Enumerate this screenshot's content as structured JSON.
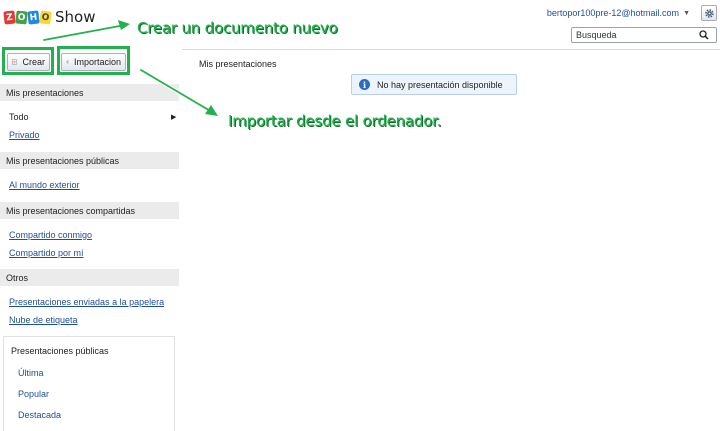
{
  "app": {
    "logo_letters": [
      "Z",
      "O",
      "H",
      "O"
    ],
    "product_name": "Show"
  },
  "header": {
    "user_email": "bertopor100pre-12@hotmail.com",
    "search_placeholder": "Busqueda"
  },
  "toolbar": {
    "create_label": "Crear",
    "import_label": "Importacion"
  },
  "sidebar": {
    "sections": {
      "my_presentations": "Mis presentaciones",
      "public": "Mis presentaciones públicas",
      "shared": "Mis presentaciones compartidas",
      "others": "Otros"
    },
    "all": "Todo",
    "private": "Privado",
    "outside_world": "Al mundo exterior",
    "shared_with_me": "Compartido conmigo",
    "shared_by_me": "Compartido por mí",
    "trash": "Presentaciones enviadas a la papelera",
    "tag_cloud": "Nube de etiqueta",
    "public_box": {
      "title": "Presentaciones públicas",
      "links": [
        "Última",
        "Popular",
        "Destacada"
      ]
    }
  },
  "main": {
    "title": "Mis presentaciones",
    "notice": "No hay presentación disponible"
  },
  "annotations": {
    "create": "Crear un documento nuevo",
    "import": "Importar desde el ordenador."
  },
  "colors": {
    "annotation_green": "#22b14c",
    "link_blue": "#1f4e9c",
    "section_bg": "#ebebeb"
  }
}
